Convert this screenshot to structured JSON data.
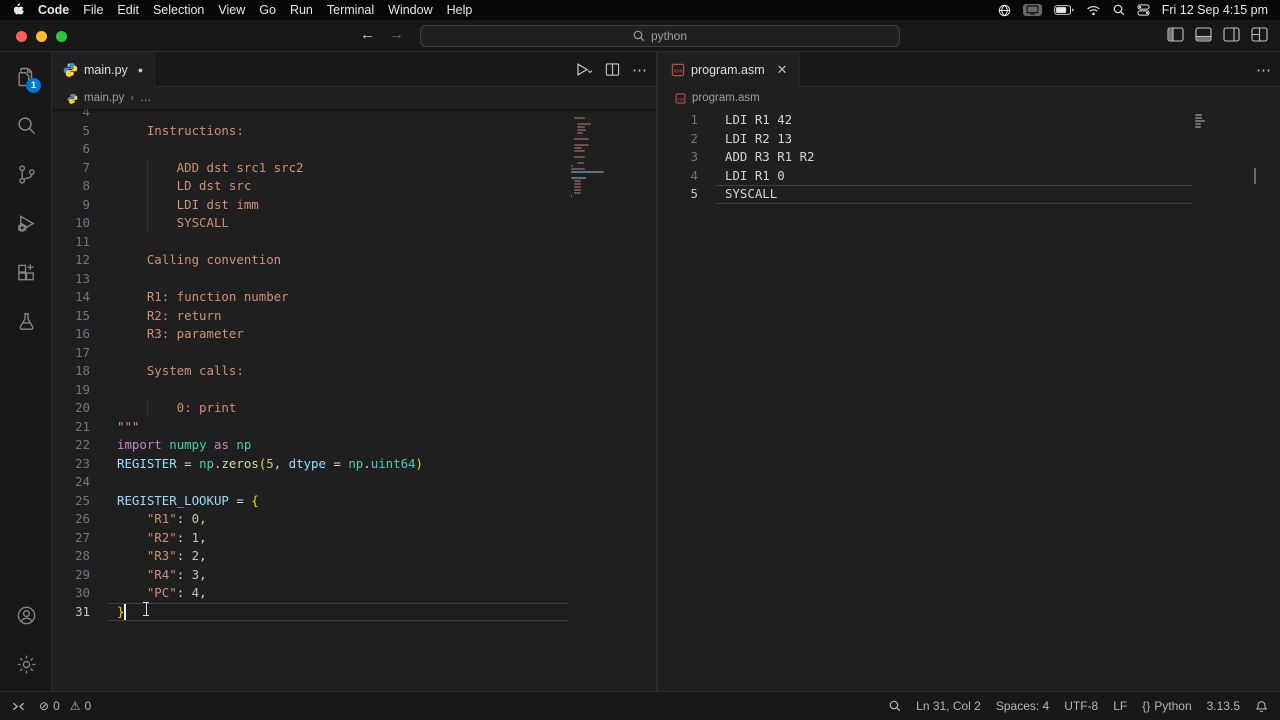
{
  "menu_bar": {
    "items": [
      "Code",
      "File",
      "Edit",
      "Selection",
      "View",
      "Go",
      "Run",
      "Terminal",
      "Window",
      "Help"
    ],
    "status_icons": [
      "input-source",
      "display-mirroring",
      "battery",
      "wifi",
      "spotlight",
      "control-center"
    ],
    "clock": "Fri 12 Sep 4:15 pm"
  },
  "title_bar": {
    "search_value": "python"
  },
  "activity_bar": {
    "explorer_badge": "1"
  },
  "editors": [
    {
      "tab_label": "main.py",
      "modified": true,
      "breadcrumb_file": "main.py",
      "breadcrumb_more": "…",
      "active_line": 31,
      "cursor": {
        "line": 31,
        "col": 2
      },
      "lines": [
        {
          "num": 4,
          "segs": []
        },
        {
          "num": 5,
          "segs": [
            {
              "t": "    Instructions:",
              "c": "#ce9178"
            }
          ]
        },
        {
          "num": 6,
          "segs": []
        },
        {
          "num": 7,
          "segs": [
            {
              "t": "        ADD dst src1 src2",
              "c": "#ce9178"
            }
          ]
        },
        {
          "num": 8,
          "segs": [
            {
              "t": "        LD dst src",
              "c": "#ce9178"
            }
          ]
        },
        {
          "num": 9,
          "segs": [
            {
              "t": "        LDI dst imm",
              "c": "#ce9178"
            }
          ]
        },
        {
          "num": 10,
          "segs": [
            {
              "t": "        SYSCALL",
              "c": "#ce9178"
            }
          ]
        },
        {
          "num": 11,
          "segs": []
        },
        {
          "num": 12,
          "segs": [
            {
              "t": "    Calling convention",
              "c": "#ce9178"
            }
          ]
        },
        {
          "num": 13,
          "segs": []
        },
        {
          "num": 14,
          "segs": [
            {
              "t": "    R1: function number",
              "c": "#ce9178"
            }
          ]
        },
        {
          "num": 15,
          "segs": [
            {
              "t": "    R2: return",
              "c": "#ce9178"
            }
          ]
        },
        {
          "num": 16,
          "segs": [
            {
              "t": "    R3: parameter",
              "c": "#ce9178"
            }
          ]
        },
        {
          "num": 17,
          "segs": []
        },
        {
          "num": 18,
          "segs": [
            {
              "t": "    System calls:",
              "c": "#ce9178"
            }
          ]
        },
        {
          "num": 19,
          "segs": []
        },
        {
          "num": 20,
          "segs": [
            {
              "t": "        0: print",
              "c": "#ce9178"
            }
          ]
        },
        {
          "num": 21,
          "segs": [
            {
              "t": "\"\"\"",
              "c": "#ce9178"
            }
          ]
        },
        {
          "num": 22,
          "segs": [
            {
              "t": "import",
              "c": "#c586c0"
            },
            {
              "t": " ",
              "c": "#d4d4d4"
            },
            {
              "t": "numpy",
              "c": "#4ec9b5"
            },
            {
              "t": " ",
              "c": "#d4d4d4"
            },
            {
              "t": "as",
              "c": "#c586c0"
            },
            {
              "t": " ",
              "c": "#d4d4d4"
            },
            {
              "t": "np",
              "c": "#4ec9b5"
            }
          ]
        },
        {
          "num": 23,
          "segs": [
            {
              "t": "REGISTER",
              "c": "#9cdcfe"
            },
            {
              "t": " = ",
              "c": "#d4d4d4"
            },
            {
              "t": "np",
              "c": "#4ec9b5"
            },
            {
              "t": ".",
              "c": "#d4d4d4"
            },
            {
              "t": "zeros",
              "c": "#dcdcaa"
            },
            {
              "t": "(",
              "c": "#ffd700"
            },
            {
              "t": "5",
              "c": "#b5cea8"
            },
            {
              "t": ", ",
              "c": "#d4d4d4"
            },
            {
              "t": "dtype",
              "c": "#9cdcfe"
            },
            {
              "t": " = ",
              "c": "#d4d4d4"
            },
            {
              "t": "np",
              "c": "#4ec9b5"
            },
            {
              "t": ".",
              "c": "#d4d4d4"
            },
            {
              "t": "uint64",
              "c": "#4ec9b5"
            },
            {
              "t": ")",
              "c": "#ffd700"
            }
          ]
        },
        {
          "num": 24,
          "segs": []
        },
        {
          "num": 25,
          "segs": [
            {
              "t": "REGISTER_LOOKUP",
              "c": "#9cdcfe"
            },
            {
              "t": " = ",
              "c": "#d4d4d4"
            },
            {
              "t": "{",
              "c": "#ffd700"
            }
          ]
        },
        {
          "num": 26,
          "segs": [
            {
              "t": "    \"R1\"",
              "c": "#ce9178"
            },
            {
              "t": ": ",
              "c": "#d4d4d4"
            },
            {
              "t": "0",
              "c": "#b5cea8"
            },
            {
              "t": ",",
              "c": "#d4d4d4"
            }
          ]
        },
        {
          "num": 27,
          "segs": [
            {
              "t": "    \"R2\"",
              "c": "#ce9178"
            },
            {
              "t": ": ",
              "c": "#d4d4d4"
            },
            {
              "t": "1",
              "c": "#b5cea8"
            },
            {
              "t": ",",
              "c": "#d4d4d4"
            }
          ]
        },
        {
          "num": 28,
          "segs": [
            {
              "t": "    \"R3\"",
              "c": "#ce9178"
            },
            {
              "t": ": ",
              "c": "#d4d4d4"
            },
            {
              "t": "2",
              "c": "#b5cea8"
            },
            {
              "t": ",",
              "c": "#d4d4d4"
            }
          ]
        },
        {
          "num": 29,
          "segs": [
            {
              "t": "    \"R4\"",
              "c": "#ce9178"
            },
            {
              "t": ": ",
              "c": "#d4d4d4"
            },
            {
              "t": "3",
              "c": "#b5cea8"
            },
            {
              "t": ",",
              "c": "#d4d4d4"
            }
          ]
        },
        {
          "num": 30,
          "segs": [
            {
              "t": "    \"PC\"",
              "c": "#ce9178"
            },
            {
              "t": ": ",
              "c": "#d4d4d4"
            },
            {
              "t": "4",
              "c": "#b5cea8"
            },
            {
              "t": ",",
              "c": "#d4d4d4"
            }
          ]
        },
        {
          "num": 31,
          "segs": [
            {
              "t": "}",
              "c": "#ffd700"
            }
          ]
        }
      ]
    },
    {
      "tab_label": "program.asm",
      "modified": false,
      "breadcrumb_file": "program.asm",
      "active_line": 5,
      "lines": [
        {
          "num": 1,
          "segs": [
            {
              "t": "LDI R1 42",
              "c": "#d4d4d4"
            }
          ]
        },
        {
          "num": 2,
          "segs": [
            {
              "t": "LDI R2 13",
              "c": "#d4d4d4"
            }
          ]
        },
        {
          "num": 3,
          "segs": [
            {
              "t": "ADD R3 R1 R2",
              "c": "#d4d4d4"
            }
          ]
        },
        {
          "num": 4,
          "segs": [
            {
              "t": "LDI R1 0",
              "c": "#d4d4d4"
            }
          ]
        },
        {
          "num": 5,
          "segs": [
            {
              "t": "SYSCALL",
              "c": "#d4d4d4"
            }
          ]
        }
      ]
    }
  ],
  "status_bar": {
    "errors": "0",
    "warnings": "0",
    "line_col": "Ln 31, Col 2",
    "indentation": "Spaces: 4",
    "encoding": "UTF-8",
    "eol": "LF",
    "braces": "{}",
    "language": "Python",
    "interpreter": "3.13.5"
  },
  "colors": {
    "badge": "#0078d4",
    "editor_background": "#1f1f1f",
    "frame_background": "#181818",
    "traffic_red": "#ff5f57",
    "traffic_yellow": "#febc2e",
    "traffic_green": "#28c840"
  }
}
